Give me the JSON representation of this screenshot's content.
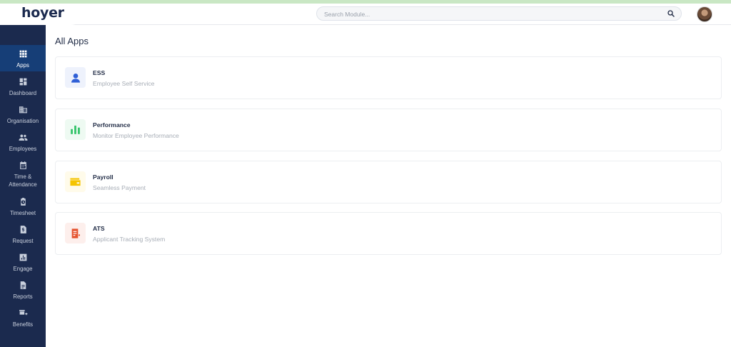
{
  "header": {
    "logo": "hoyer",
    "search_placeholder": "Search Module..."
  },
  "sidebar": {
    "items": [
      {
        "label": "Apps",
        "icon": "apps-grid-icon",
        "active": true
      },
      {
        "label": "Dashboard",
        "icon": "dashboard-icon"
      },
      {
        "label": "Organisation",
        "icon": "organisation-icon"
      },
      {
        "label": "Employees",
        "icon": "employees-icon"
      },
      {
        "label": "Time &\nAttendance",
        "icon": "calendar-icon"
      },
      {
        "label": "Timesheet",
        "icon": "timesheet-icon"
      },
      {
        "label": "Request",
        "icon": "request-icon"
      },
      {
        "label": "Engage",
        "icon": "engage-icon"
      },
      {
        "label": "Reports",
        "icon": "reports-icon"
      },
      {
        "label": "Benefits",
        "icon": "benefits-icon"
      }
    ]
  },
  "main": {
    "title": "All Apps",
    "apps": [
      {
        "name": "ESS",
        "description": "Employee Self Service",
        "icon": "person-icon",
        "color": "#2f5fd6",
        "bg": "#eef2fc"
      },
      {
        "name": "Performance",
        "description": "Monitor Employee Performance",
        "icon": "bar-chart-icon",
        "color": "#34c46a",
        "bg": "#eefaf2"
      },
      {
        "name": "Payroll",
        "description": "Seamless Payment",
        "icon": "wallet-icon",
        "color": "#f5c400",
        "bg": "#fffbea"
      },
      {
        "name": "ATS",
        "description": "Applicant Tracking System",
        "icon": "document-icon",
        "color": "#e5532f",
        "bg": "#fdefec"
      }
    ]
  },
  "colors": {
    "sidebar_bg": "#1b2a4e",
    "sidebar_active": "#163e77",
    "top_strip": "#c9e7c4"
  }
}
